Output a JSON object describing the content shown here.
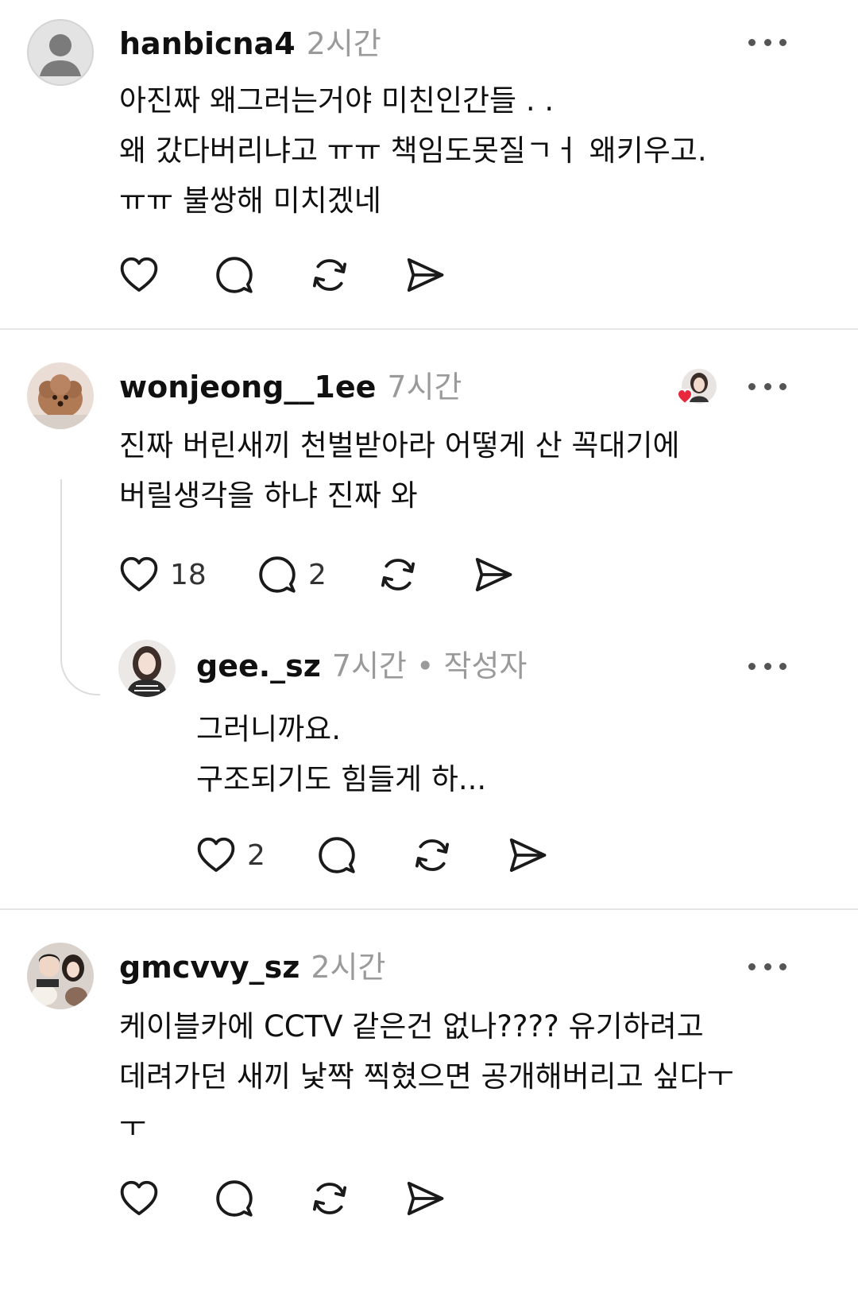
{
  "posts": [
    {
      "username": "hanbicna4",
      "time": "2시간",
      "text": "아진짜 왜그러는거야 미친인간들 . .\n왜 갔다버리냐고 ㅠㅠ 책임도못질ㄱㅓ 왜키우고.\nㅠㅠ 불쌍해 미치겠네",
      "likes": "",
      "replies": ""
    },
    {
      "username": "wonjeong__1ee",
      "time": "7시간",
      "text": "진짜 버린새끼 천벌받아라 어떻게 산 꼭대기에\n버릴생각을 하냐 진짜 와",
      "likes": "18",
      "replies": "2",
      "reply": {
        "username": "gee._sz",
        "time": "7시간",
        "author_badge": "• 작성자",
        "text": "그러니까요.\n구조되기도 힘들게 하...",
        "likes": "2",
        "replies": ""
      }
    },
    {
      "username": "gmcvvy_sz",
      "time": "2시간",
      "text": "케이블카에 CCTV 같은건 없나???? 유기하려고\n데려가던 새끼 낯짝 찍혔으면 공개해버리고 싶다ㅜ\nㅜ",
      "likes": "",
      "replies": ""
    }
  ],
  "icons": {
    "like": "heart-icon",
    "comment": "comment-bubble-icon",
    "repost": "repost-icon",
    "share": "send-icon",
    "more": "more-dots-icon",
    "liked_by_author": "heart-badge-icon"
  },
  "colors": {
    "text": "#101010",
    "muted": "#9a9a9a",
    "divider": "#e6e6e6",
    "heart_red": "#e8283c"
  }
}
